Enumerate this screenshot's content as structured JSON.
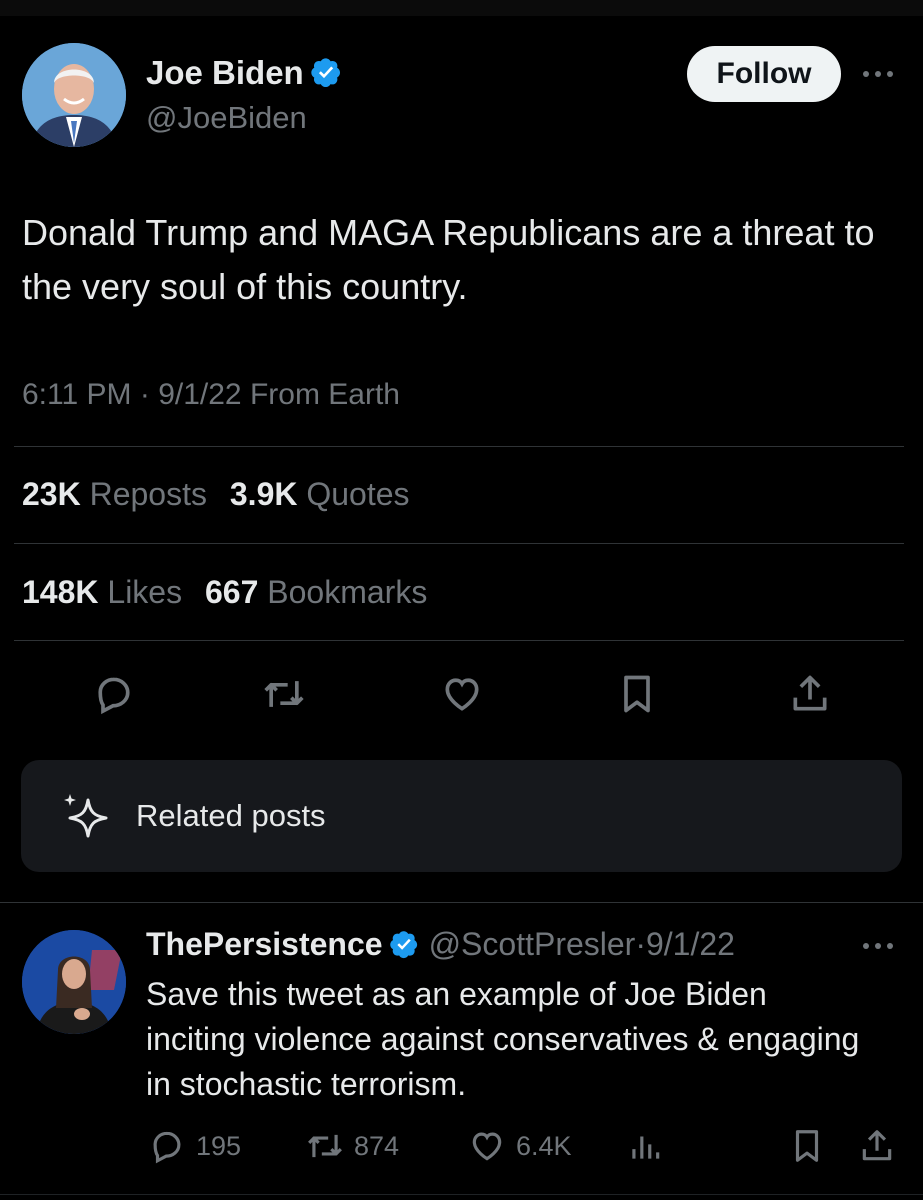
{
  "author": {
    "name": "Joe Biden",
    "handle": "@JoeBiden",
    "verified": true
  },
  "follow_label": "Follow",
  "post": {
    "text": "Donald Trump and MAGA Republicans are a threat to the very soul of this country.",
    "time": "6:11 PM",
    "separator": "·",
    "date": "9/1/22",
    "source": "From Earth"
  },
  "stats": {
    "reposts": {
      "count": "23K",
      "label": "Reposts"
    },
    "quotes": {
      "count": "3.9K",
      "label": "Quotes"
    },
    "likes": {
      "count": "148K",
      "label": "Likes"
    },
    "bookmarks": {
      "count": "667",
      "label": "Bookmarks"
    }
  },
  "actions": [
    "reply-icon",
    "repost-icon",
    "like-icon",
    "bookmark-icon",
    "share-icon"
  ],
  "related": {
    "label": "Related posts",
    "icon": "sparkle-icon"
  },
  "reply": {
    "name": "ThePersistence",
    "verified": true,
    "handle": "@ScottPresler",
    "separator": "·",
    "date": "9/1/22",
    "text": "Save this tweet as an example of Joe Biden inciting violence against conservatives & engaging in stochastic terrorism.",
    "replies": "195",
    "reposts": "874",
    "likes": "6.4K"
  },
  "colors": {
    "background": "#000000",
    "text": "#e7e9ea",
    "muted": "#71767b",
    "divider": "#2f3336",
    "verified": "#1d9bf0",
    "card": "#16181c"
  }
}
